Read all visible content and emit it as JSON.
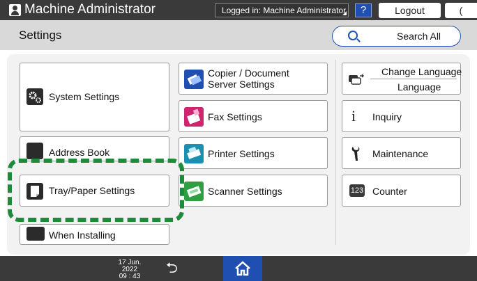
{
  "header": {
    "app_title": "Machine Administrator",
    "login_status": "Logged in: Machine Administrator",
    "help_label": "?",
    "logout_label": "Logout",
    "dark_mode_label": "("
  },
  "subheader": {
    "page_title": "Settings",
    "search_label": "Search All"
  },
  "tiles": {
    "system_settings": "System Settings",
    "address_book": "Address Book",
    "tray_paper_settings": "Tray/Paper Settings",
    "when_installing": "When Installing",
    "copier_line1": "Copier / Document",
    "copier_line2": "Server Settings",
    "fax_settings": "Fax Settings",
    "printer_settings": "Printer Settings",
    "scanner_settings": "Scanner Settings",
    "change_language": "Change Language",
    "language": "Language",
    "inquiry": "Inquiry",
    "maintenance": "Maintenance",
    "counter": "Counter",
    "counter_badge": "123"
  },
  "footer": {
    "date": "17 Jun. 2022",
    "time": "09 : 43"
  },
  "colors": {
    "accent_blue": "#1f4fb0",
    "highlight_green": "#1e8a3a",
    "topbar": "#3a3a3a"
  }
}
